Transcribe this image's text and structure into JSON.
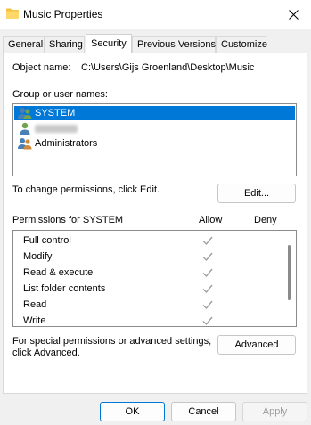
{
  "window": {
    "title": "Music Properties",
    "close_icon": "close-icon"
  },
  "tabs": [
    {
      "label": "General",
      "active": false
    },
    {
      "label": "Sharing",
      "active": false
    },
    {
      "label": "Security",
      "active": true
    },
    {
      "label": "Previous Versions",
      "active": false
    },
    {
      "label": "Customize",
      "active": false
    }
  ],
  "object": {
    "label": "Object name:",
    "value": "C:\\Users\\Gijs Groenland\\Desktop\\Music"
  },
  "groups": {
    "label": "Group or user names:",
    "users": [
      {
        "name": "SYSTEM",
        "icon": "user-group-icon",
        "selected": true
      },
      {
        "name": "",
        "icon": "user-icon",
        "selected": false,
        "redacted": true
      },
      {
        "name": "Administrators",
        "icon": "user-group-icon",
        "selected": false
      }
    ]
  },
  "change_permissions": {
    "text": "To change permissions, click Edit.",
    "edit_label": "Edit..."
  },
  "permissions": {
    "header": "Permissions for SYSTEM",
    "allow_label": "Allow",
    "deny_label": "Deny",
    "rows": [
      {
        "name": "Full control",
        "allow": true,
        "deny": false
      },
      {
        "name": "Modify",
        "allow": true,
        "deny": false
      },
      {
        "name": "Read & execute",
        "allow": true,
        "deny": false
      },
      {
        "name": "List folder contents",
        "allow": true,
        "deny": false
      },
      {
        "name": "Read",
        "allow": true,
        "deny": false
      },
      {
        "name": "Write",
        "allow": true,
        "deny": false
      }
    ]
  },
  "special": {
    "line1": "For special permissions or advanced settings,",
    "line2": "click Advanced.",
    "advanced_label": "Advanced"
  },
  "footer": {
    "ok_label": "OK",
    "cancel_label": "Cancel",
    "apply_label": "Apply"
  },
  "colors": {
    "selection": "#0078d7",
    "check_gray": "#a0a0a0",
    "folder_yellow": "#f5c242"
  }
}
